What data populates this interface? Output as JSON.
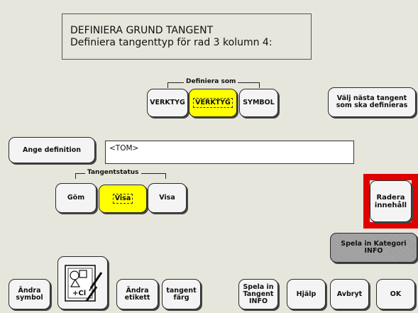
{
  "header": {
    "line1": "DEFINIERA GRUND TANGENT",
    "line2": "Definiera tangenttyp för rad 3 kolumn 4:"
  },
  "define_as": {
    "title": "Definiera som",
    "options": [
      "VERKTYG",
      "VERKTYG",
      "SYMBOL"
    ],
    "selected_index": 1
  },
  "next_key_button": "Välj nästa tangent\nsom ska definieras",
  "enter_definition_button": "Ange definition",
  "definition_value": "<TOM>",
  "key_status": {
    "title": "Tangentstatus",
    "options": [
      "Göm",
      "Visa",
      "Visa"
    ],
    "selected_index": 1
  },
  "clear_contents_button": "Radera\ninnehåll",
  "record_category_button": "Spela in Kategori\nINFO",
  "bottom_bar": {
    "change_symbol": "Ändra\nsymbol",
    "symbol_icon_text": "+Cl",
    "change_label": "Ändra\netikett",
    "key_color": "tangent\nfärg",
    "record_key_info": "Spela in\nTangent\nINFO",
    "help": "Hjälp",
    "cancel": "Avbryt",
    "ok": "OK"
  },
  "colors": {
    "background": "#e7e6dc",
    "selected": "#ffff00",
    "highlight_frame": "#e00000",
    "disabled": "#9b9b9b"
  }
}
